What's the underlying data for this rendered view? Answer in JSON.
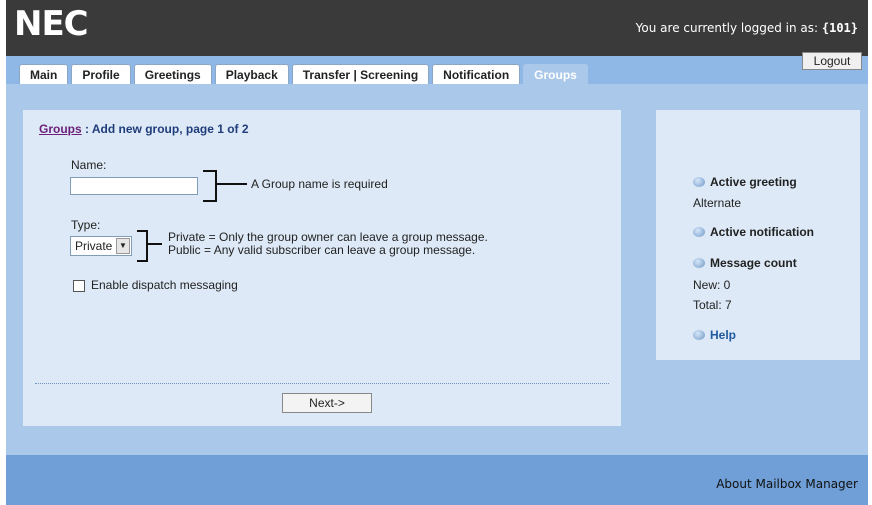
{
  "header": {
    "logo": "NEC",
    "login_prefix": "You are currently logged in as: ",
    "login_user": "{101}",
    "logout_label": "Logout"
  },
  "tabs": [
    {
      "label": "Main"
    },
    {
      "label": "Profile"
    },
    {
      "label": "Greetings"
    },
    {
      "label": "Playback"
    },
    {
      "label": "Transfer | Screening"
    },
    {
      "label": "Notification"
    },
    {
      "label": "Groups",
      "active": true
    }
  ],
  "form": {
    "breadcrumb_link": "Groups",
    "breadcrumb_rest": " : Add new group, page 1 of 2",
    "name_label": "Name:",
    "name_value": "",
    "name_hint": "A Group name is required",
    "type_label": "Type:",
    "type_selected": "Private",
    "type_hint_private": "Private = Only the group owner can leave a group message.",
    "type_hint_public": "Public = Any valid subscriber can leave a group message.",
    "dispatch_label": "Enable dispatch messaging",
    "dispatch_checked": false,
    "next_label": "Next->"
  },
  "sidebar": {
    "active_greeting_title": "Active greeting",
    "active_greeting_value": "Alternate",
    "active_notification_title": "Active notification",
    "message_count_title": "Message count",
    "new_count": "New: 0",
    "total_count": "Total: 7",
    "help_label": "Help"
  },
  "footer": {
    "about_label": "About Mailbox Manager"
  },
  "colors": {
    "topbar": "#3a3a3a",
    "background": "#a9c8ea",
    "panel": "#dde9f6",
    "footer": "#6f9fd6",
    "link": "#6b1f7a",
    "heading": "#1f3d7a"
  }
}
